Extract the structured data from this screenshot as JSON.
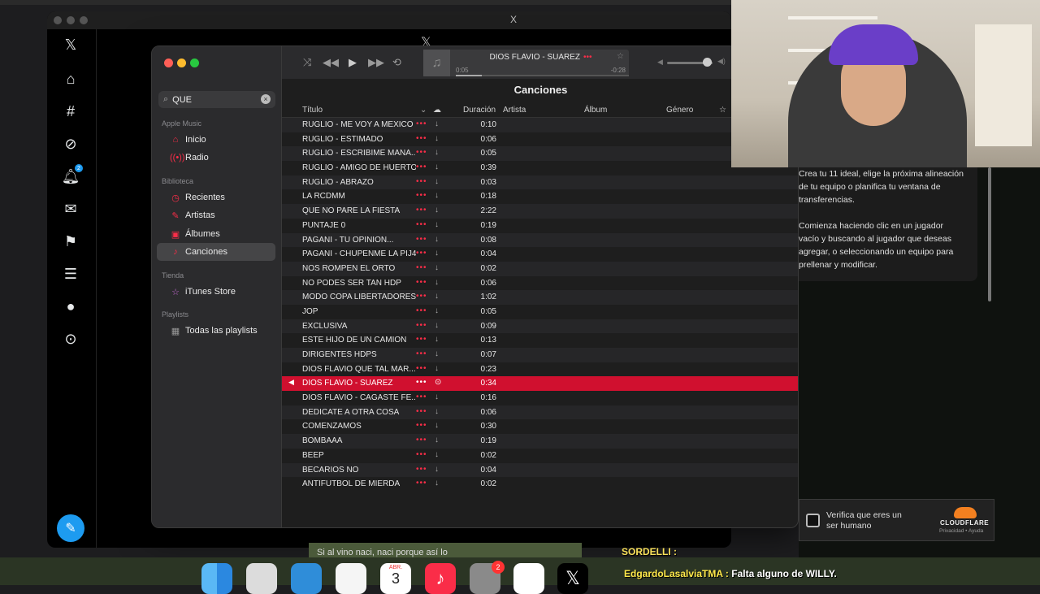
{
  "xwindow": {
    "title": "X",
    "center_logo": "𝕏",
    "notification_badge": "2"
  },
  "music": {
    "search": {
      "value": "QUE"
    },
    "sidebar": {
      "sections": [
        {
          "title": "Apple Music",
          "items": [
            {
              "label": "Inicio",
              "icon": "home-icon"
            },
            {
              "label": "Radio",
              "icon": "radio-icon"
            }
          ]
        },
        {
          "title": "Biblioteca",
          "items": [
            {
              "label": "Recientes",
              "icon": "clock-icon"
            },
            {
              "label": "Artistas",
              "icon": "microphone-icon"
            },
            {
              "label": "Álbumes",
              "icon": "album-icon"
            },
            {
              "label": "Canciones",
              "icon": "note-icon",
              "active": true
            }
          ]
        },
        {
          "title": "Tienda",
          "items": [
            {
              "label": "iTunes Store",
              "icon": "star-icon"
            }
          ]
        },
        {
          "title": "Playlists",
          "items": [
            {
              "label": "Todas las playlists",
              "icon": "grid-icon"
            }
          ]
        }
      ]
    },
    "now_playing": {
      "title": "DIOS FLAVIO - SUAREZ",
      "elapsed": "0:05",
      "remaining": "-0:28",
      "progress": 0.15
    },
    "volume": 0.8,
    "heading": "Canciones",
    "columns": {
      "title": "Título",
      "duration": "Duración",
      "artist": "Artista",
      "album": "Álbum",
      "genre": "Género"
    },
    "songs": [
      {
        "title": "RUGLIO - ME VOY A MEXICO",
        "duration": "0:10"
      },
      {
        "title": "RUGLIO - ESTIMADO",
        "duration": "0:06"
      },
      {
        "title": "RUGLIO - ESCRIBIME MANA...",
        "duration": "0:05"
      },
      {
        "title": "RUGLIO - AMIGO DE HUERTO",
        "duration": "0:39"
      },
      {
        "title": "RUGLIO - ABRAZO",
        "duration": "0:03"
      },
      {
        "title": "LA RCDMM",
        "duration": "0:18"
      },
      {
        "title": "QUE NO PARE LA FIESTA",
        "duration": "2:22"
      },
      {
        "title": "PUNTAJE 0",
        "duration": "0:19"
      },
      {
        "title": "PAGANI - TU OPINION...",
        "duration": "0:08"
      },
      {
        "title": "PAGANI - CHUPENME LA PIJ4",
        "duration": "0:04"
      },
      {
        "title": "NOS ROMPEN EL ORTO",
        "duration": "0:02"
      },
      {
        "title": "NO PODES SER TAN HDP",
        "duration": "0:06"
      },
      {
        "title": "MODO COPA LIBERTADORES",
        "duration": "1:02"
      },
      {
        "title": "JOP",
        "duration": "0:05"
      },
      {
        "title": "EXCLUSIVA",
        "duration": "0:09"
      },
      {
        "title": "ESTE HIJO DE UN CAMION",
        "duration": "0:13"
      },
      {
        "title": "DIRIGENTES HDPS",
        "duration": "0:07"
      },
      {
        "title": "DIOS FLAVIO QUE TAL MAR...",
        "duration": "0:23"
      },
      {
        "title": "DIOS FLAVIO - SUAREZ",
        "duration": "0:34",
        "playing": true
      },
      {
        "title": "DIOS FLAVIO - CAGASTE FE...",
        "duration": "0:16"
      },
      {
        "title": "DEDICATE A OTRA COSA",
        "duration": "0:06"
      },
      {
        "title": "COMENZAMOS",
        "duration": "0:30"
      },
      {
        "title": "BOMBAAA",
        "duration": "0:19"
      },
      {
        "title": "BEEP",
        "duration": "0:02"
      },
      {
        "title": "BECARIOS NO",
        "duration": "0:04"
      },
      {
        "title": "ANTIFUTBOL DE MIERDA",
        "duration": "0:02"
      }
    ]
  },
  "right_panel": {
    "text1": "Crea tu 11 ideal, elige la próxima alineación de tu equipo o planifica tu ventana de transferencias.",
    "text2": "Comienza haciendo clic en un jugador vacío y buscando al jugador que deseas agregar, o seleccionando un equipo para prellenar y modificar."
  },
  "cloudflare": {
    "text": "Verifica que eres un ser humano",
    "brand": "CLOUDFLARE",
    "links": "Privacidad • Ayuda"
  },
  "subtitle": "Si al vino naci, naci porque así lo",
  "dock": {
    "calendar_month": "ABR.",
    "calendar_day": "3",
    "settings_badge": "2"
  },
  "chat": {
    "line1": "SORDELLI :",
    "user": "EdgardoLasalviaTMA :",
    "message": "Falta alguno de WILLY."
  }
}
